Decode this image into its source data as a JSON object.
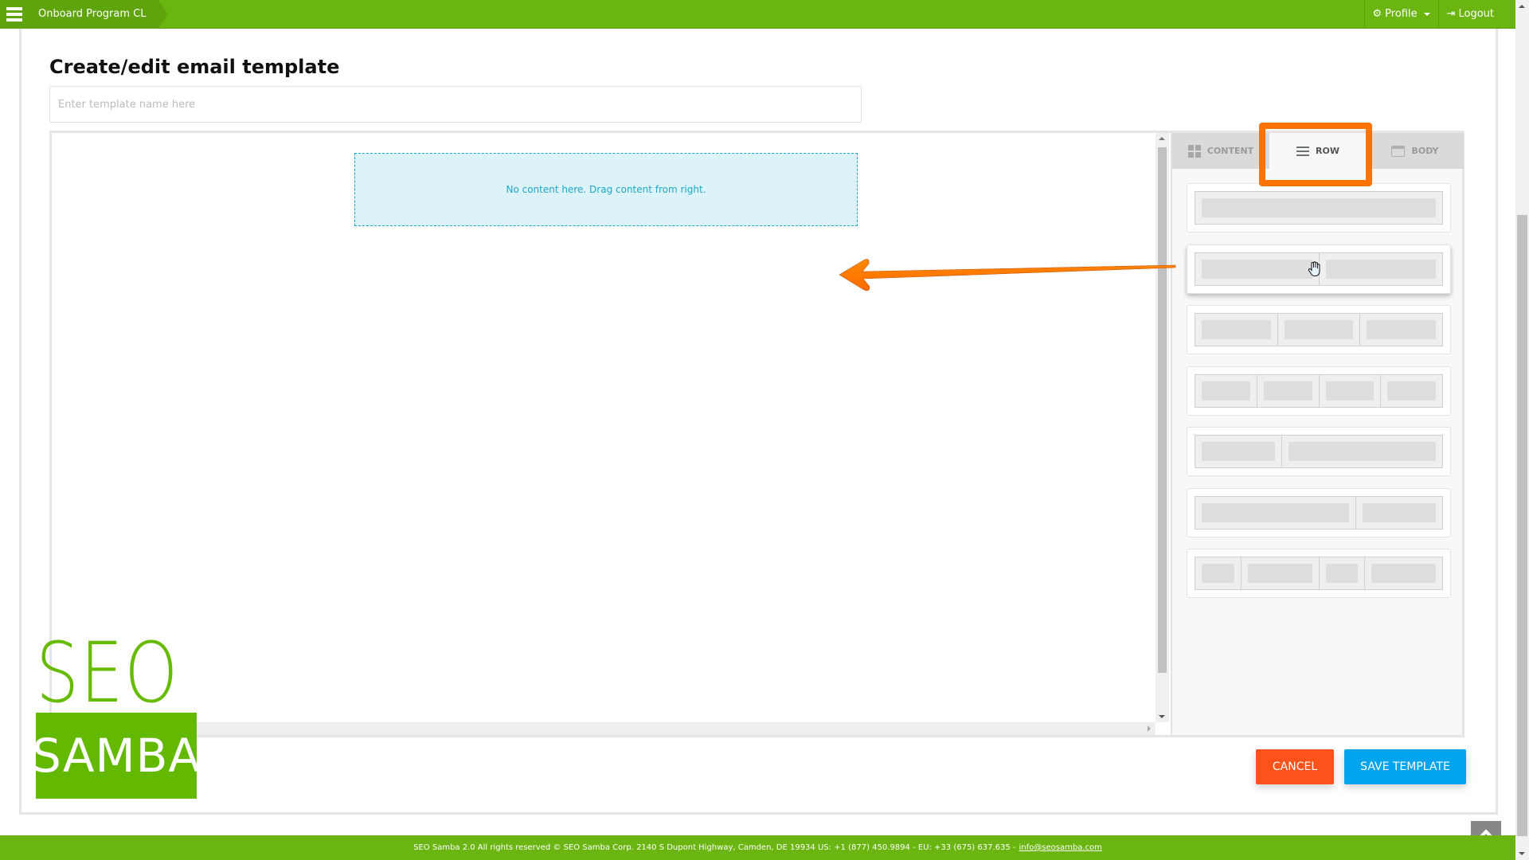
{
  "topbar": {
    "breadcrumb": "Onboard Program CL",
    "profile_label": "Profile",
    "logout_label": "Logout"
  },
  "page": {
    "title": "Create/edit email template",
    "name_input": {
      "value": "",
      "placeholder": "Enter template name here"
    }
  },
  "canvas": {
    "empty_message": "No content here. Drag content from right."
  },
  "panel": {
    "tabs": [
      {
        "label": "CONTENT",
        "icon": "grid-icon",
        "active": false
      },
      {
        "label": "ROW",
        "icon": "lines-icon",
        "active": true
      },
      {
        "label": "BODY",
        "icon": "body-icon",
        "active": false
      }
    ],
    "row_layouts": [
      {
        "name": "1 column",
        "columns": [
          12
        ]
      },
      {
        "name": "2 columns",
        "columns": [
          6,
          6
        ]
      },
      {
        "name": "3 columns",
        "columns": [
          4,
          4,
          4
        ]
      },
      {
        "name": "4 columns",
        "columns": [
          3,
          3,
          3,
          3
        ]
      },
      {
        "name": "1/3 + 2/3",
        "columns": [
          4,
          8
        ]
      },
      {
        "name": "2/3 + 1/3",
        "columns": [
          8,
          4
        ]
      },
      {
        "name": "mixed 4",
        "columns": [
          2,
          4,
          2,
          4
        ]
      }
    ]
  },
  "annotations": {
    "highlight_color": "#ff7300",
    "arrow_color": "#ff7300"
  },
  "actions": {
    "cancel_label": "CANCEL",
    "save_label": "SAVE TEMPLATE"
  },
  "logo": {
    "line1": "SEO",
    "line2": "SAMBA"
  },
  "footer": {
    "text": "SEO Samba 2.0  All rights reserved © SEO Samba Corp. 2140 S Dupont Highway, Camden, DE 19934 US: +1 (877) 450.9894 - EU: +33 (675) 637.635 -",
    "email": "info@seosamba.com"
  },
  "colors": {
    "brand_green": "#6ab50f",
    "cancel": "#fd5219",
    "save": "#02a4ee",
    "dropzone_bg": "#dcf3f9",
    "dropzone_text": "#1fa7c8"
  }
}
